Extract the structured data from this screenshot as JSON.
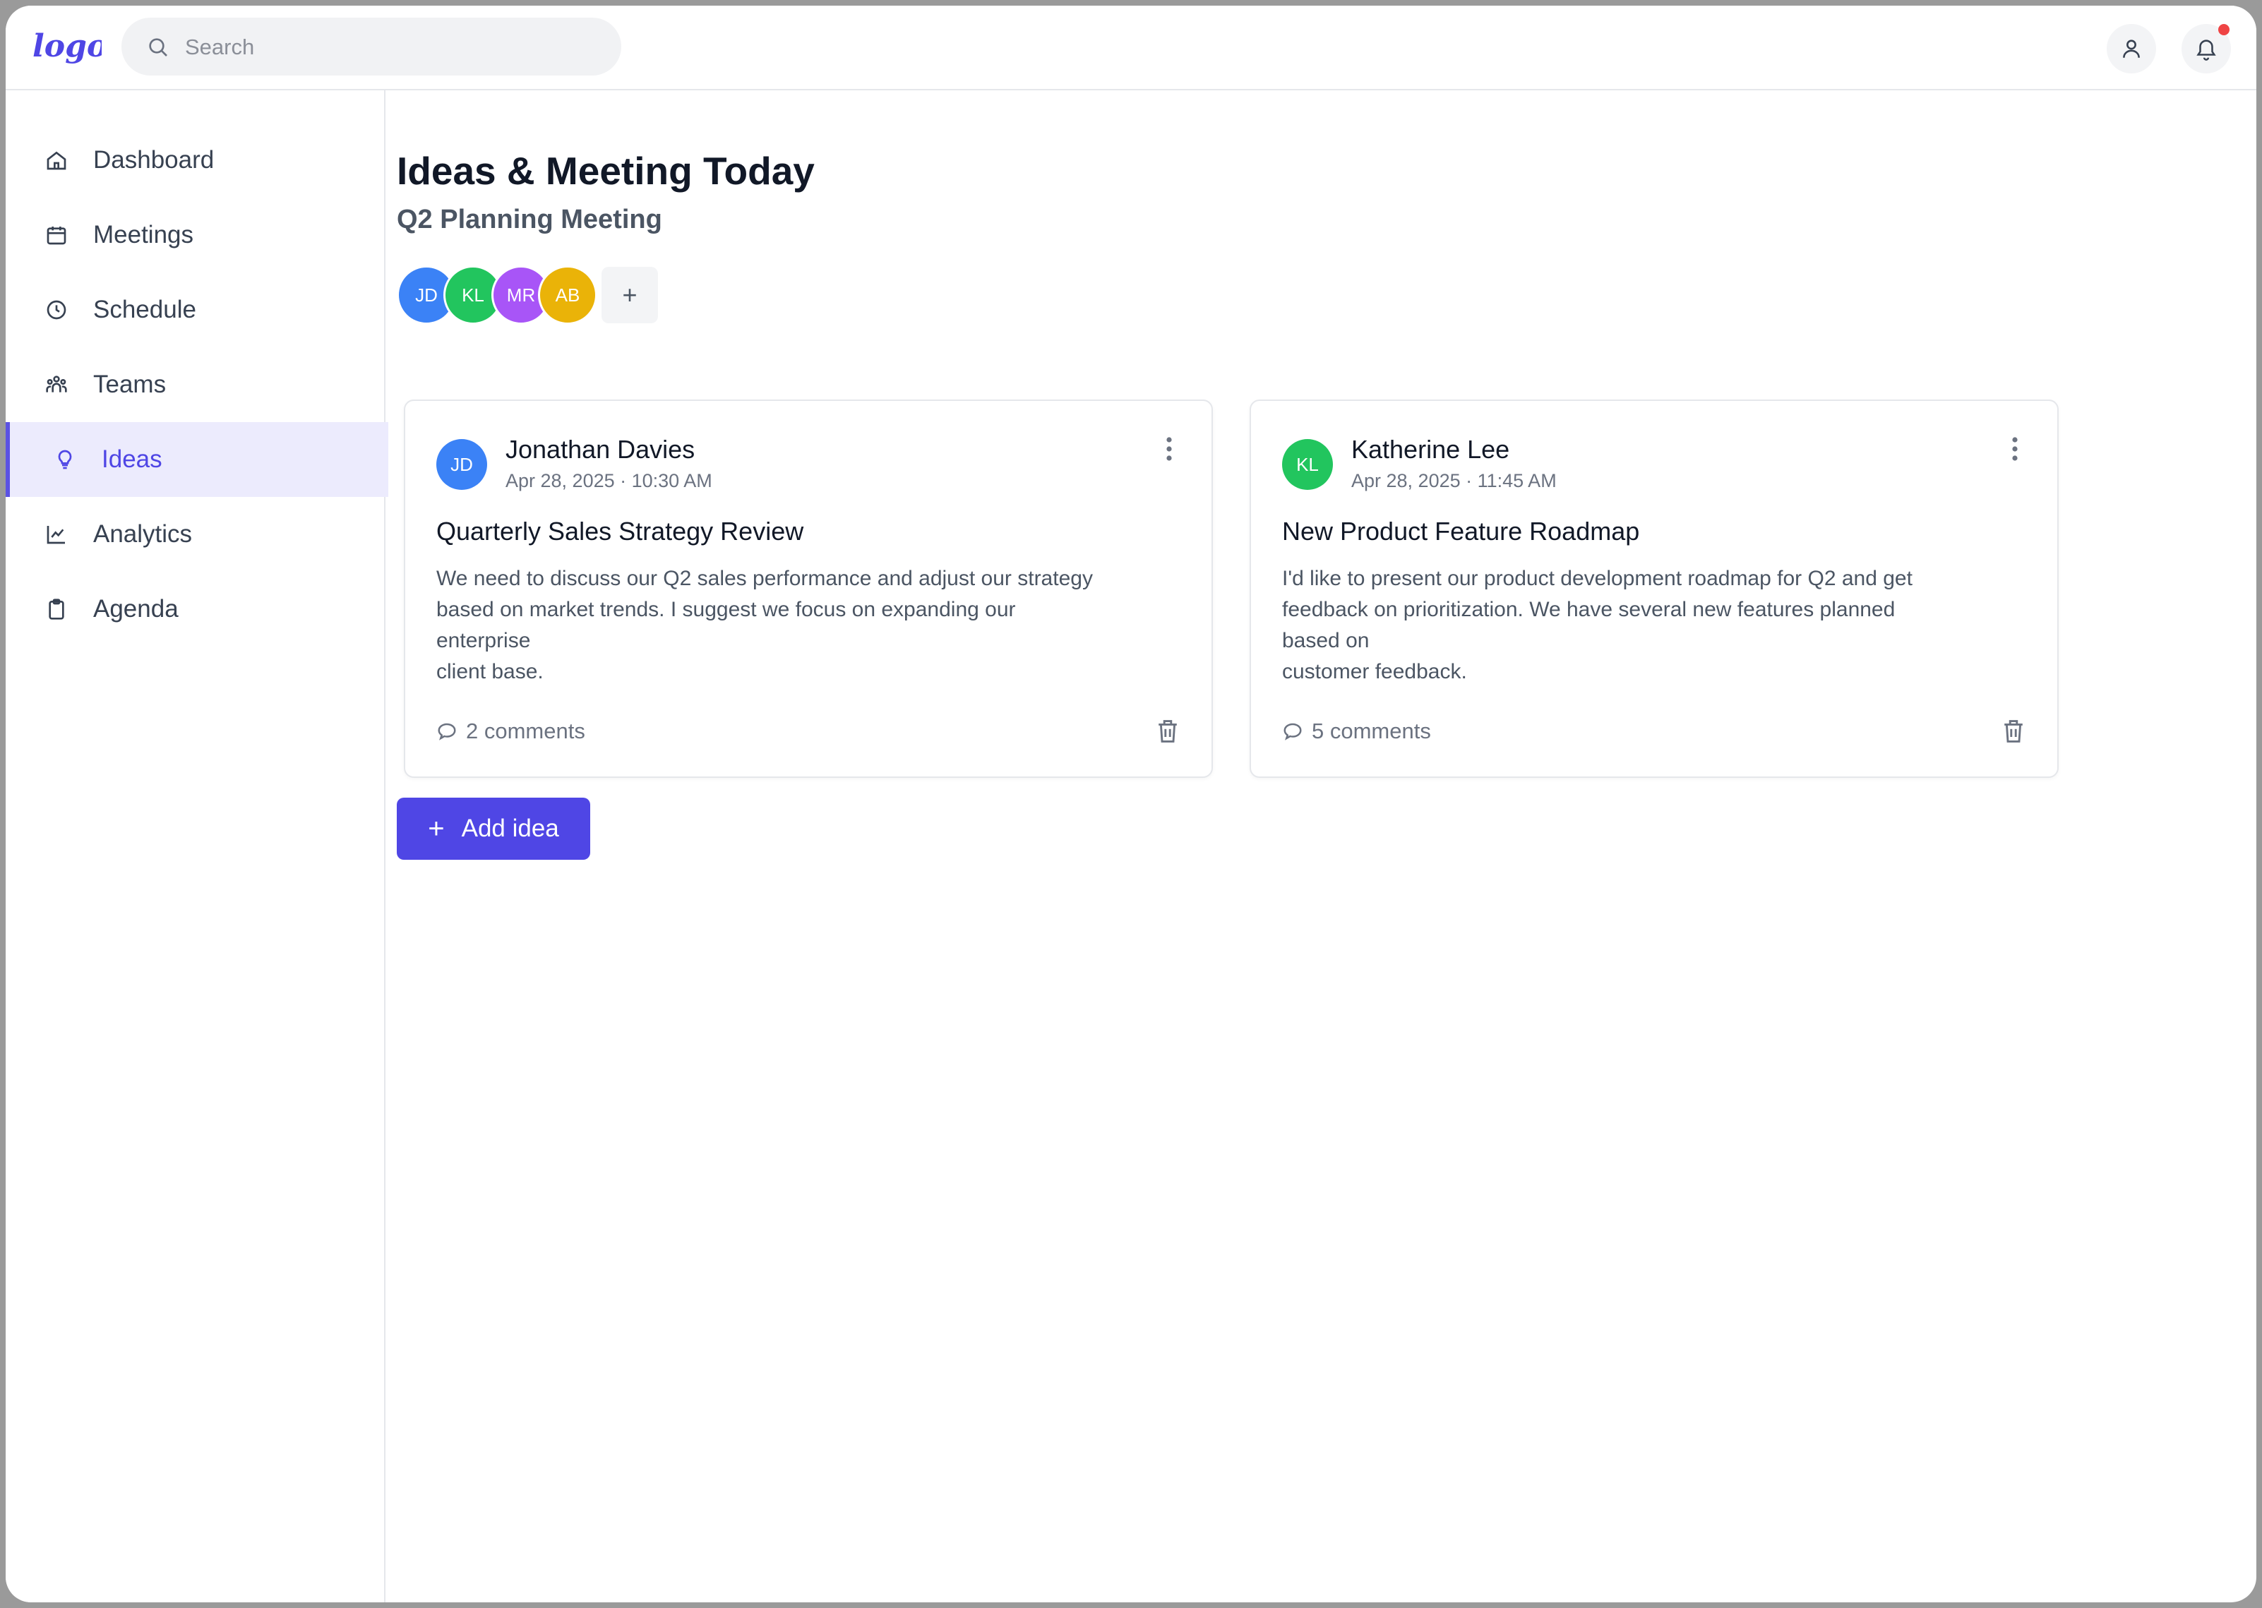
{
  "brand": {
    "logo_text": "logo",
    "accent": "#4f46e5"
  },
  "search": {
    "placeholder": "Search",
    "value": ""
  },
  "header": {
    "profile_icon": "user-icon",
    "notifications_icon": "bell-icon",
    "notification_dot": true
  },
  "sidebar": {
    "items": [
      {
        "label": "Dashboard",
        "icon": "home-icon",
        "active": false
      },
      {
        "label": "Meetings",
        "icon": "calendar-icon",
        "active": false
      },
      {
        "label": "Schedule",
        "icon": "clock-icon",
        "active": false
      },
      {
        "label": "Teams",
        "icon": "team-icon",
        "active": false
      },
      {
        "label": "Ideas",
        "icon": "lightbulb-icon",
        "active": true
      },
      {
        "label": "Analytics",
        "icon": "chart-icon",
        "active": false
      },
      {
        "label": "Agenda",
        "icon": "clipboard-icon",
        "active": false
      }
    ]
  },
  "main": {
    "title": "Ideas & Meeting Today",
    "subtitle": "Q2 Planning Meeting",
    "participants": [
      {
        "initials": "JD",
        "color": "#3b82f6"
      },
      {
        "initials": "KL",
        "color": "#22c55e"
      },
      {
        "initials": "MR",
        "color": "#a855f7"
      },
      {
        "initials": "AB",
        "color": "#eab308"
      }
    ],
    "add_participant_label": "+",
    "ideas": [
      {
        "initials": "JD",
        "avatar_color": "#3b82f6",
        "author": "Jonathan Davies",
        "timestamp": "Apr 28, 2025 · 10:30 AM",
        "title": "Quarterly Sales Strategy Review",
        "body": "We need to discuss our Q2 sales performance and adjust our strategy\nbased on market trends. I suggest we focus on expanding our\nenterprise\nclient base.",
        "comments": "2 comments"
      },
      {
        "initials": "KL",
        "avatar_color": "#22c55e",
        "author": "Katherine Lee",
        "timestamp": "Apr 28, 2025 · 11:45 AM",
        "title": "New Product Feature Roadmap",
        "body": "I'd like to present our product development roadmap for Q2 and get\nfeedback on prioritization. We have several new features planned\nbased on\ncustomer feedback.",
        "comments": "5 comments"
      }
    ],
    "add_idea": {
      "plus": "+",
      "label": "Add idea"
    }
  }
}
